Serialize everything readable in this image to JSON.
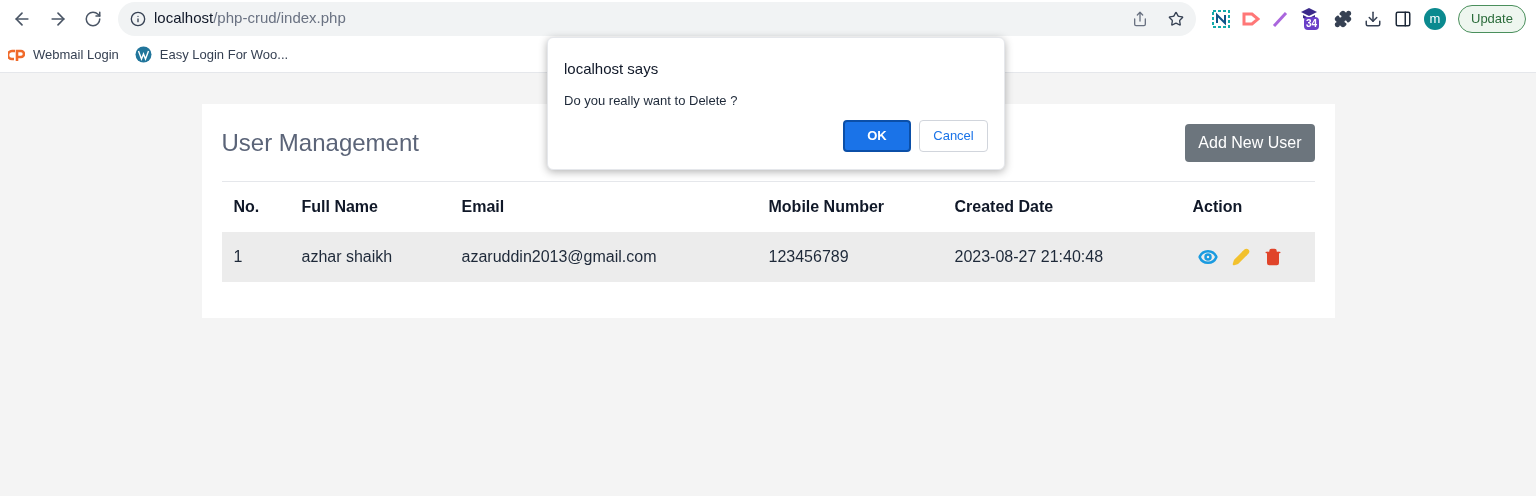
{
  "browser": {
    "url_host": "localhost",
    "url_path": "/php-crud/index.php",
    "extension_badge": "34",
    "profile_initial": "m",
    "update_button": "Update"
  },
  "bookmarks": [
    {
      "label": "Webmail Login",
      "kind": "cpanel"
    },
    {
      "label": "Easy Login For Woo...",
      "kind": "wordpress"
    }
  ],
  "page": {
    "title": "User Management",
    "add_button": "Add New User",
    "table": {
      "columns": [
        "No.",
        "Full Name",
        "Email",
        "Mobile Number",
        "Created Date",
        "Action"
      ],
      "rows": [
        {
          "cells": [
            "1",
            "azhar shaikh",
            "azaruddin2013@gmail.com",
            "123456789",
            "2023-08-27 21:40:48"
          ]
        }
      ]
    }
  },
  "dialog": {
    "title": "localhost says",
    "message": "Do you really want to Delete ?",
    "ok": "OK",
    "cancel": "Cancel"
  }
}
